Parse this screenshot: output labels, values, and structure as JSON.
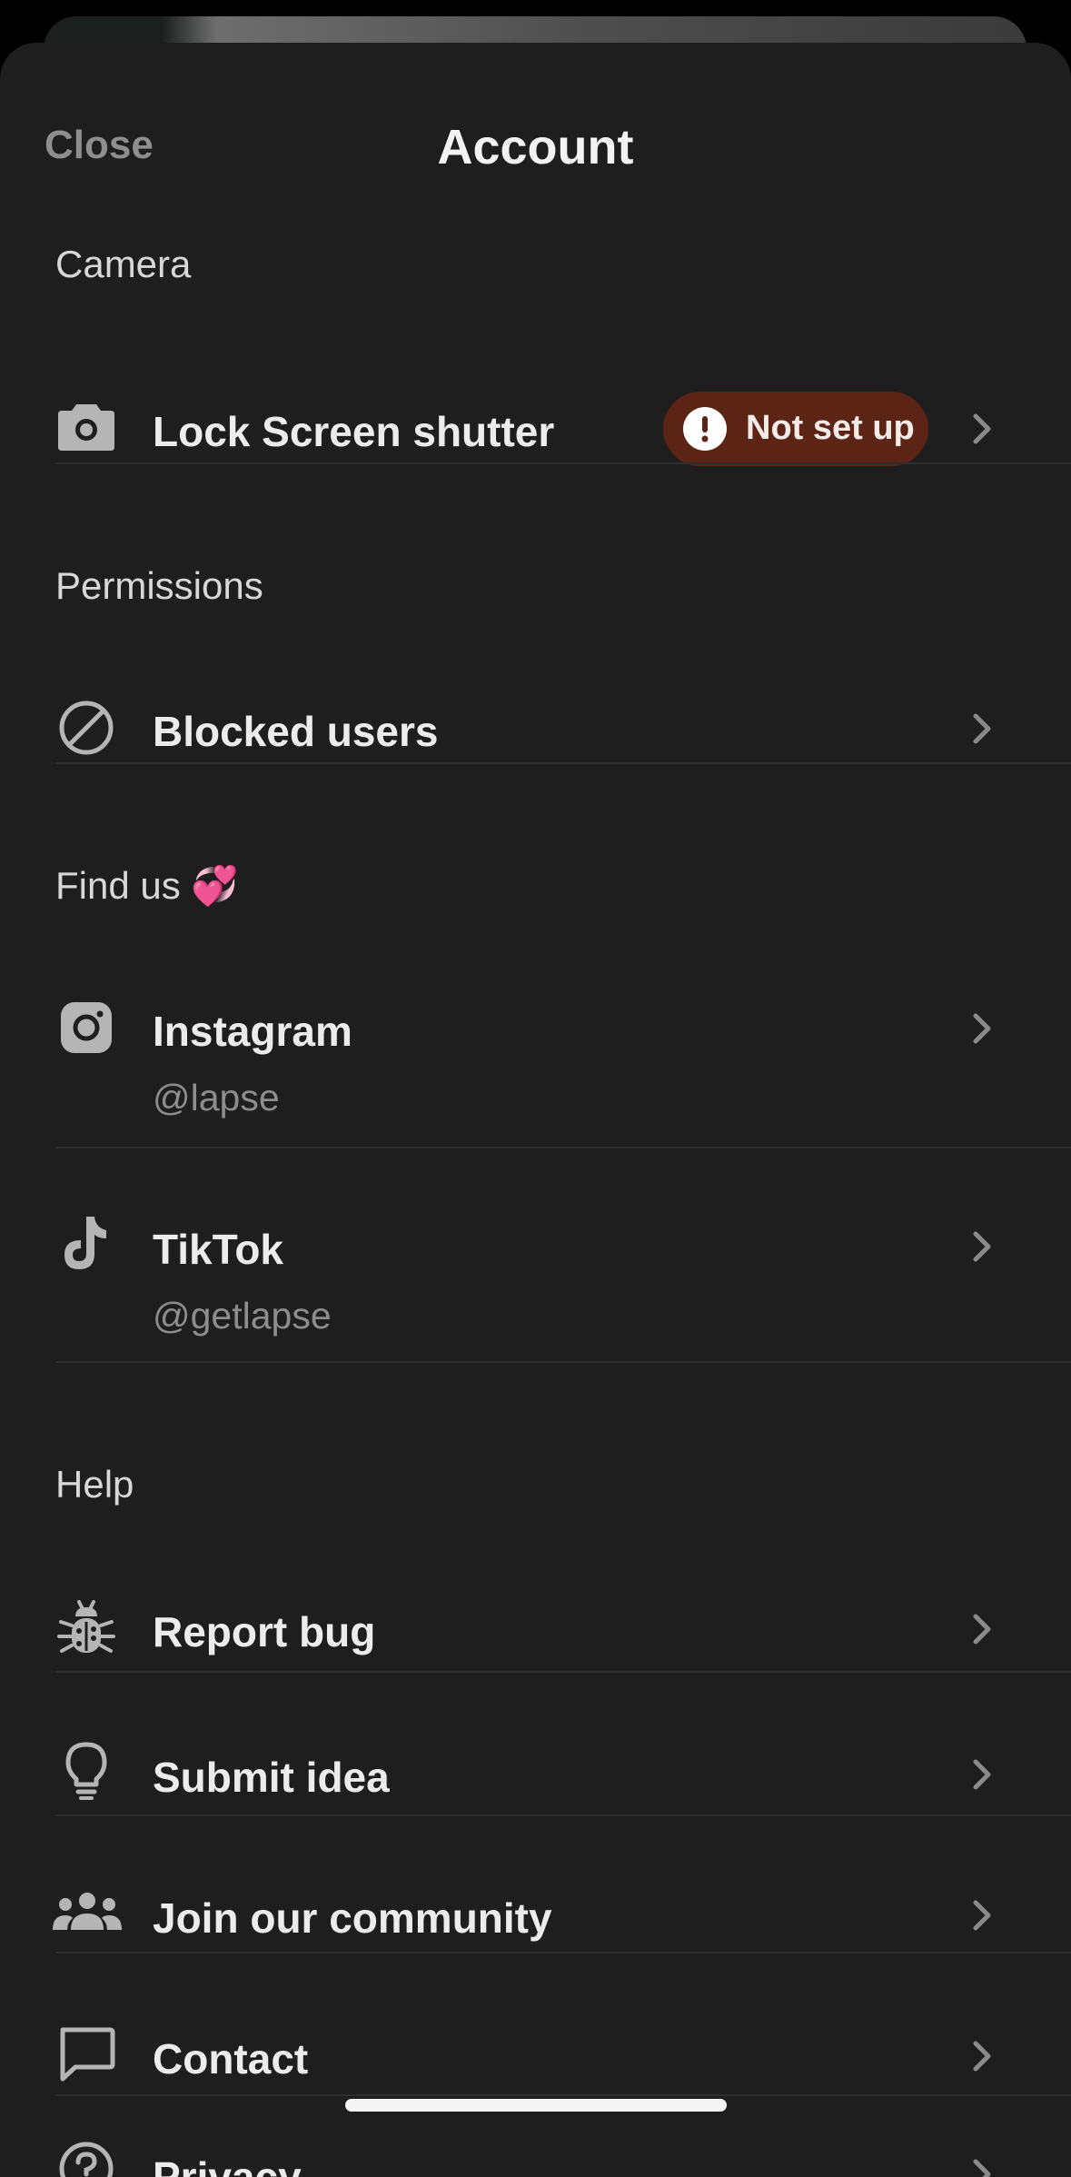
{
  "header": {
    "close_label": "Close",
    "title": "Account"
  },
  "sections": {
    "camera": {
      "label": "Camera",
      "lock_screen": {
        "label": "Lock Screen shutter",
        "badge": "Not set up",
        "icon": "camera-icon"
      }
    },
    "permissions": {
      "label": "Permissions",
      "blocked": {
        "label": "Blocked users",
        "icon": "blocked-icon"
      }
    },
    "find_us": {
      "label": "Find us 💞",
      "instagram": {
        "label": "Instagram",
        "handle": "@lapse",
        "icon": "instagram-icon"
      },
      "tiktok": {
        "label": "TikTok",
        "handle": "@getlapse",
        "icon": "tiktok-icon"
      }
    },
    "help": {
      "label": "Help",
      "report_bug": {
        "label": "Report bug",
        "icon": "bug-icon"
      },
      "submit_idea": {
        "label": "Submit idea",
        "icon": "lightbulb-icon"
      },
      "community": {
        "label": "Join our community",
        "icon": "people-icon"
      },
      "contact": {
        "label": "Contact",
        "icon": "chat-bubble-icon"
      },
      "privacy": {
        "label": "Privacy",
        "icon": "help-circle-icon"
      }
    }
  },
  "colors": {
    "background": "#1e1e1e",
    "badge_bg": "#5c2415",
    "muted_text": "#8d8d8d"
  }
}
